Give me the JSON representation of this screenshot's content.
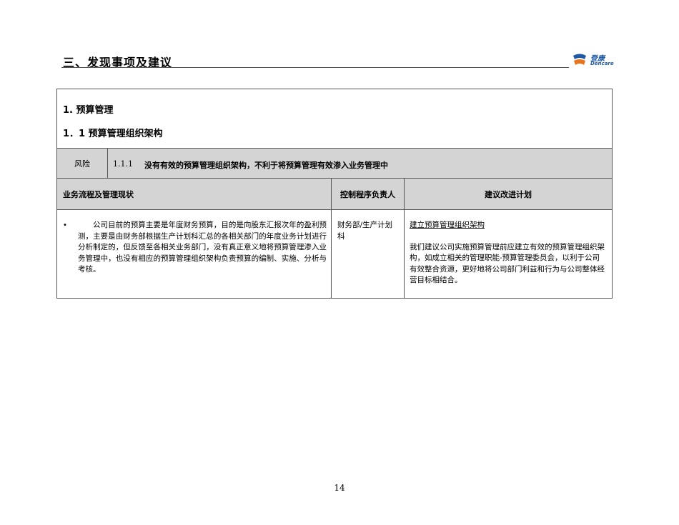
{
  "header": {
    "title": "三、发现事项及建议",
    "logo_cn": "登康",
    "logo_en": "Dencare"
  },
  "section": {
    "heading": "1.  预算管理",
    "subheading": "1．1   预算管理组织架构"
  },
  "risk": {
    "label": "风险",
    "number": "1.1.1",
    "text": "没有有效的预算管理组织架构，不利于将预算管理有效渗入业务管理中"
  },
  "table": {
    "headers": [
      "业务流程及管理现状",
      "控制程序负责人",
      "建议改进计划"
    ],
    "status_bullet": "•",
    "status_text": "公司目前的预算主要是年度财务预算，目的是向股东汇报次年的盈利预测，主要是由财务部根据生产计划科汇总的各相关部门的年度业务计划进行分析制定的，但反馈至各相关业务部门，没有真正意义地将预算管理渗入业务管理中，也没有相应的预算管理组织架构负责预算的编制、实施、分析与考核。",
    "owner": "财务部/生产计划科",
    "plan_title": "建立预算管理组织架构",
    "plan_text": "我们建议公司实施预算管理前应建立有效的预算管理组织架构，如成立相关的管理职能-预算管理委员会，以利于公司有效整合资源，更好地将公司部门利益和行为与公司整体经营目标相结合。"
  },
  "footer": {
    "page_number": "14"
  },
  "colors": {
    "header_fill": "#d4d4d4",
    "border": "#555555",
    "logo_blue": "#1f5aa6",
    "logo_orange": "#e8741e"
  }
}
